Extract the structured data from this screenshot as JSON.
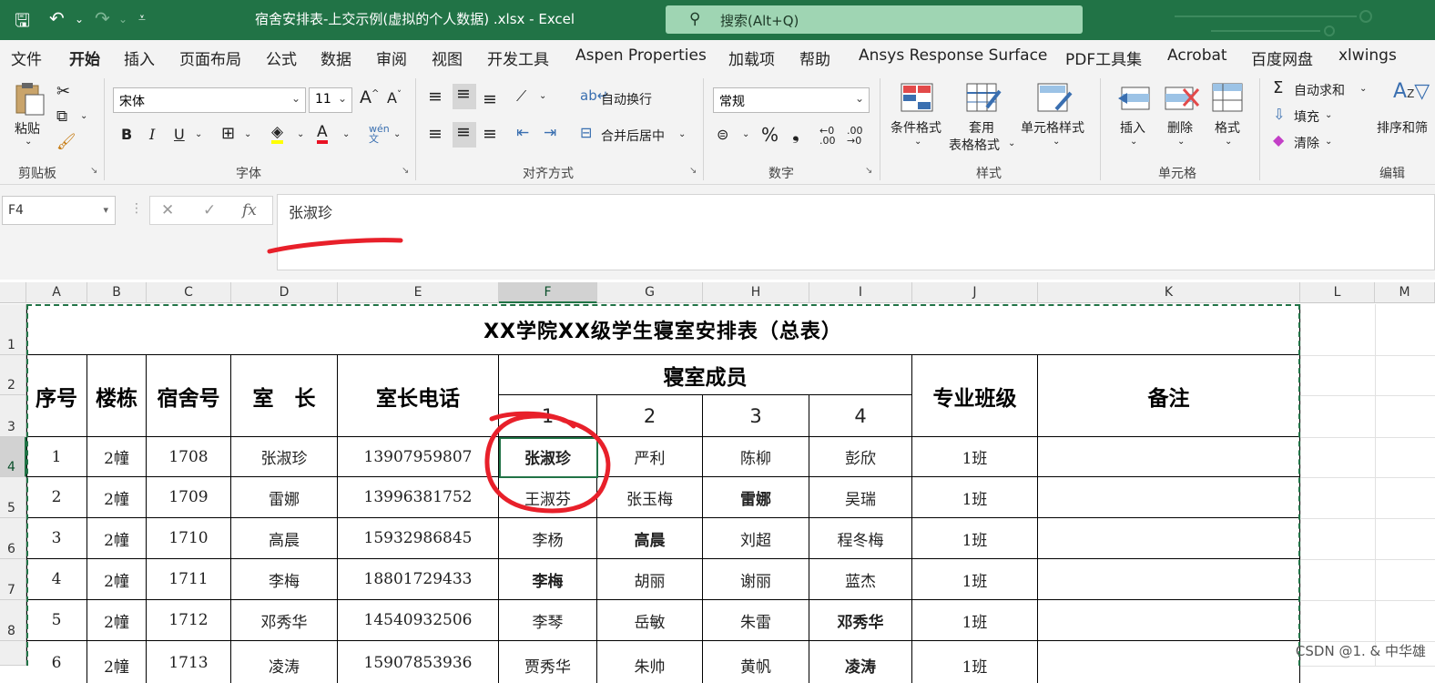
{
  "titlebar": {
    "doc_title": "宿舍安排表-上交示例(虚拟的个人数据) .xlsx  -  Excel",
    "search_placeholder": "搜索(Alt+Q)",
    "save_icon": "save-icon",
    "undo_icon": "undo-icon",
    "redo_icon": "redo-icon"
  },
  "tabs": [
    "文件",
    "开始",
    "插入",
    "页面布局",
    "公式",
    "数据",
    "审阅",
    "视图",
    "开发工具",
    "Aspen Properties",
    "加载项",
    "帮助",
    "Ansys Response Surface",
    "PDF工具集",
    "Acrobat",
    "百度网盘",
    "xlwings"
  ],
  "active_tab": "开始",
  "ribbon": {
    "clipboard": {
      "paste": "粘贴",
      "label": "剪贴板"
    },
    "font": {
      "name": "宋体",
      "size": "11",
      "bold": "B",
      "italic": "I",
      "underline": "U",
      "label": "字体"
    },
    "alignment": {
      "wrap": "自动换行",
      "merge": "合并后居中",
      "label": "对齐方式"
    },
    "number": {
      "format": "常规",
      "percent": "%",
      "label": "数字"
    },
    "styles": {
      "conditional": "条件格式",
      "table_line1": "套用",
      "table_line2": "表格格式",
      "cell_styles": "单元格样式",
      "label": "样式"
    },
    "cells": {
      "insert": "插入",
      "delete": "删除",
      "format": "格式",
      "label": "单元格"
    },
    "editing": {
      "autosum": "自动求和",
      "fill": "填充",
      "clear": "清除",
      "sort": "排序和筛",
      "label": "编辑"
    }
  },
  "formula_bar": {
    "name_box": "F4",
    "cancel": "✕",
    "enter": "✓",
    "fx": "fx",
    "content": "张淑珍"
  },
  "columns": [
    "A",
    "B",
    "C",
    "D",
    "E",
    "F",
    "G",
    "H",
    "I",
    "J",
    "K",
    "L",
    "M"
  ],
  "rows": [
    "1",
    "2",
    "3",
    "4",
    "5",
    "6",
    "7",
    "8"
  ],
  "sheet": {
    "title": "XX学院XX级学生寝室安排表（总表）",
    "headers": {
      "seq": "序号",
      "building": "楼栋",
      "room": "宿舍号",
      "leader": "室　长",
      "phone": "室长电话",
      "members": "寝室成员",
      "class": "专业班级",
      "note": "备注"
    },
    "member_nums": [
      "1",
      "2",
      "3",
      "4"
    ],
    "data": [
      {
        "seq": "1",
        "building": "2幢",
        "room": "1708",
        "leader": "张淑珍",
        "phone": "13907959807",
        "m1": "张淑珍",
        "m2": "严利",
        "m3": "陈柳",
        "m4": "彭欣",
        "class": "1班"
      },
      {
        "seq": "2",
        "building": "2幢",
        "room": "1709",
        "leader": "雷娜",
        "phone": "13996381752",
        "m1": "王淑芬",
        "m2": "张玉梅",
        "m3": "雷娜",
        "m4": "吴瑞",
        "class": "1班"
      },
      {
        "seq": "3",
        "building": "2幢",
        "room": "1710",
        "leader": "高晨",
        "phone": "15932986845",
        "m1": "李杨",
        "m2": "高晨",
        "m3": "刘超",
        "m4": "程冬梅",
        "class": "1班"
      },
      {
        "seq": "4",
        "building": "2幢",
        "room": "1711",
        "leader": "李梅",
        "phone": "18801729433",
        "m1": "李梅",
        "m2": "胡丽",
        "m3": "谢丽",
        "m4": "蓝杰",
        "class": "1班"
      },
      {
        "seq": "5",
        "building": "2幢",
        "room": "1712",
        "leader": "邓秀华",
        "phone": "14540932506",
        "m1": "李琴",
        "m2": "岳敏",
        "m3": "朱雷",
        "m4": "邓秀华",
        "class": "1班"
      }
    ]
  },
  "bold_members": [
    "0:m1",
    "1:m3",
    "2:m2",
    "3:m1",
    "4:m4"
  ],
  "annotation_color": "#e8202a",
  "accent_color": "#217346",
  "watermark": "CSDN @1. & 中华雄"
}
